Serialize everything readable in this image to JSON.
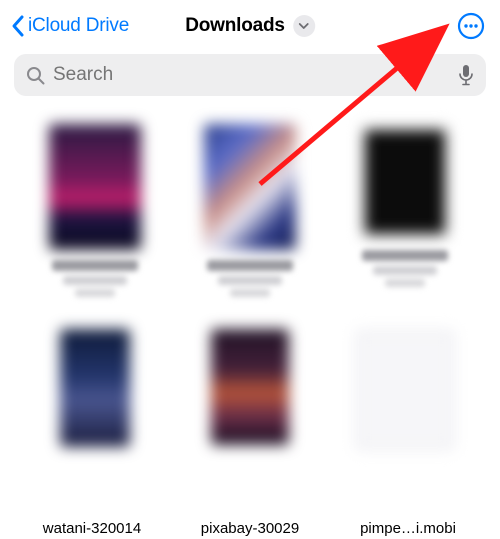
{
  "nav": {
    "back_label": "iCloud Drive",
    "title": "Downloads"
  },
  "search": {
    "placeholder": "Search"
  },
  "bottom_labels": {
    "a": "watani-320014",
    "b": "pixabay-30029",
    "c": "pimpe…i.mobi"
  },
  "colors": {
    "accent": "#007aff"
  }
}
